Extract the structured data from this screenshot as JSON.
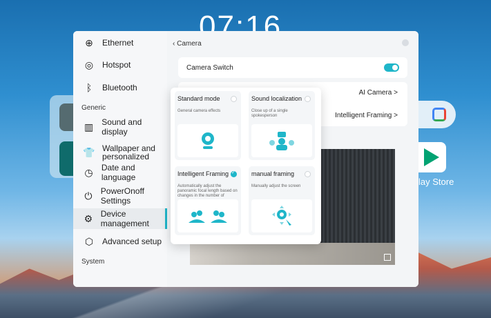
{
  "desktop": {
    "clock": "07:16",
    "play_store_label": "lay Store"
  },
  "sidebar": {
    "items": [
      {
        "label": "Ethernet",
        "icon": "ethernet-icon"
      },
      {
        "label": "Hotspot",
        "icon": "hotspot-icon"
      },
      {
        "label": "Bluetooth",
        "icon": "bluetooth-icon"
      },
      {
        "label": "Sound and display",
        "icon": "sound-display-icon"
      },
      {
        "label": "Wallpaper and personalized",
        "icon": "wallpaper-icon"
      },
      {
        "label": "Date and language",
        "icon": "clock-icon"
      },
      {
        "label": "PowerOnoff Settings",
        "icon": "power-icon"
      },
      {
        "label": "Device management",
        "icon": "device-management-icon",
        "active": true
      },
      {
        "label": "Advanced setup",
        "icon": "advanced-setup-icon"
      }
    ],
    "sections": {
      "generic": "Generic",
      "system": "System"
    }
  },
  "content": {
    "breadcrumb": "‹ Camera",
    "camera_switch_label": "Camera Switch",
    "camera_switch_on": true,
    "camera_type_value": "AI Camera >",
    "framing_value": "Intelligent Framing >"
  },
  "popup": {
    "modes": [
      {
        "title": "Standard mode",
        "desc": "General camera effects",
        "checked": false,
        "icon": "camera-icon"
      },
      {
        "title": "Sound localization",
        "desc": "Close up of a single spokesperson",
        "checked": false,
        "icon": "speaker-group-icon"
      },
      {
        "title": "Intelligent Framing",
        "desc": "Automatically adjust the panoramic focal length based on changes in the number of",
        "checked": true,
        "icon": "people-group-icon"
      },
      {
        "title": "manual framing",
        "desc": "Manually adjust the screen",
        "checked": false,
        "icon": "manual-adjust-icon"
      }
    ]
  },
  "colors": {
    "accent": "#1fb6c9"
  }
}
